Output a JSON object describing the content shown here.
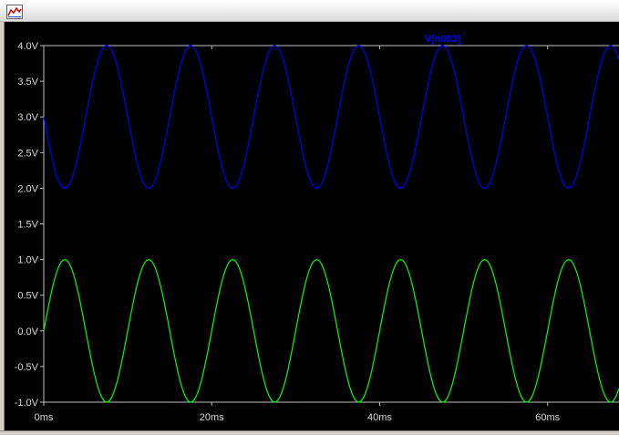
{
  "window": {
    "icon": "waveform-icon"
  },
  "chart_data": {
    "type": "line",
    "x": [
      0,
      2.5,
      5,
      7.5,
      10,
      12.5,
      15,
      17.5,
      20,
      22.5,
      25,
      27.5,
      30,
      32.5,
      35,
      37.5,
      40,
      42.5,
      45,
      47.5,
      50,
      52.5,
      55,
      57.5,
      60,
      62.5,
      65,
      67.5
    ],
    "x_unit": "ms",
    "xlim": [
      0,
      68.5
    ],
    "ylim": [
      -1.0,
      4.0
    ],
    "yticks": [
      "4.0V",
      "3.5V",
      "3.0V",
      "2.5V",
      "2.0V",
      "1.5V",
      "1.0V",
      "0.5V",
      "0.0V",
      "-0.5V",
      "-1.0V"
    ],
    "ytick_values": [
      4.0,
      3.5,
      3.0,
      2.5,
      2.0,
      1.5,
      1.0,
      0.5,
      0.0,
      -0.5,
      -1.0
    ],
    "xticks": [
      "0ms",
      "20ms",
      "40ms",
      "60ms"
    ],
    "xtick_values": [
      0,
      20,
      40,
      60
    ],
    "grid": false,
    "background": "#000000",
    "axis_color": "#c0c0c0",
    "series": [
      {
        "name": "V[n003]",
        "color": "#0000ff",
        "values": [
          3.0,
          2.0,
          3.0,
          4.0,
          3.0,
          2.0,
          3.0,
          4.0,
          3.0,
          2.0,
          3.0,
          4.0,
          3.0,
          2.0,
          3.0,
          4.0,
          3.0,
          2.0,
          3.0,
          4.0,
          3.0,
          2.0,
          3.0,
          4.0,
          3.0,
          2.0,
          3.0,
          4.0
        ]
      },
      {
        "color": "#00ff00",
        "values": [
          0.0,
          1.0,
          0.0,
          -1.0,
          0.0,
          1.0,
          0.0,
          -1.0,
          0.0,
          1.0,
          0.0,
          -1.0,
          0.0,
          1.0,
          0.0,
          -1.0,
          0.0,
          1.0,
          0.0,
          -1.0,
          0.0,
          1.0,
          0.0,
          -1.0,
          0.0,
          1.0,
          0.0,
          -1.0
        ]
      }
    ],
    "annotations": [
      {
        "text": "V[n003]",
        "color": "#0000ff",
        "x": 47.5
      }
    ]
  }
}
